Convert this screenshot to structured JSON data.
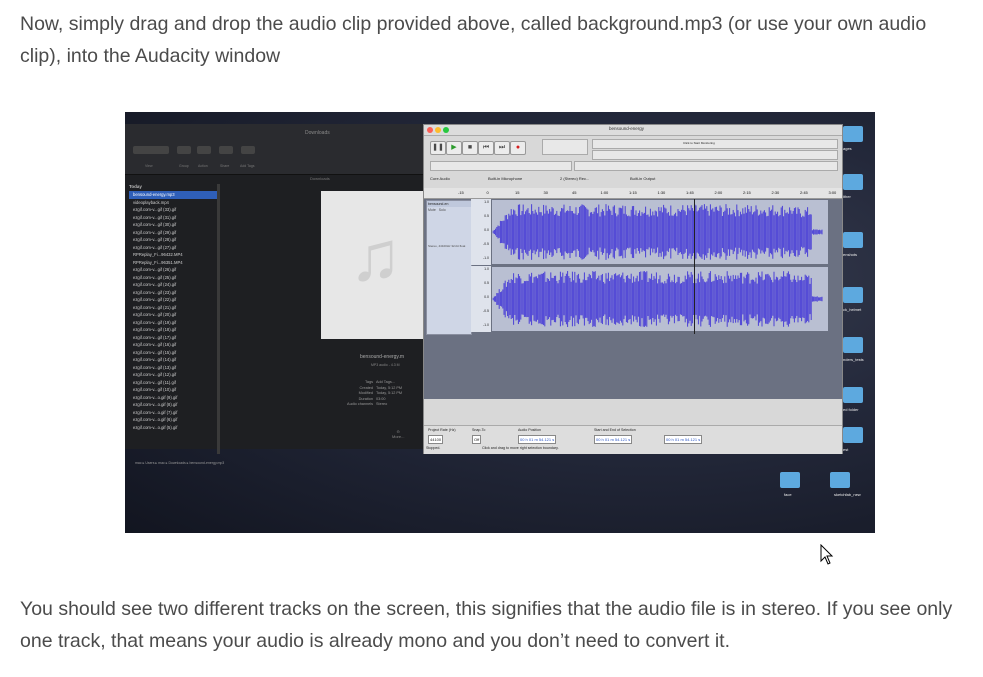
{
  "article": {
    "para1": "Now, simply drag and drop the audio clip provided above, called background.mp3 (or use your own audio clip), into the Audacity window",
    "para2": "You should see two different tracks on the screen, this signifies that the audio file is in stereo. If you see only one track, that means your audio is already mono and you don’t need to convert it."
  },
  "finder": {
    "title": "Downloads",
    "toolbar_labels": [
      "View",
      "Group",
      "Action",
      "Share",
      "Add Tags"
    ],
    "section": "Downloads",
    "today": "Today",
    "files": [
      "bensound-energy.mp3",
      "videoplayback.mp4",
      "ezgif.com-v...gif (33).gif",
      "ezgif.com-v...gif (31).gif",
      "ezgif.com-v...gif (30).gif",
      "ezgif.com-v...gif (29).gif",
      "ezgif.com-v...gif (28).gif",
      "ezgif.com-v...gif (27).gif",
      "RPReplay_Fi...96432.MP4",
      "RPReplay_Fi...96351.MP4",
      "ezgif.com-v...gif (26).gif",
      "ezgif.com-v...gif (25).gif",
      "ezgif.com-v...gif (24).gif",
      "ezgif.com-v...gif (23).gif",
      "ezgif.com-v...gif (22).gif",
      "ezgif.com-v...gif (21).gif",
      "ezgif.com-v...gif (20).gif",
      "ezgif.com-v...gif (19).gif",
      "ezgif.com-v...gif (18).gif",
      "ezgif.com-v...gif (17).gif",
      "ezgif.com-v...gif (16).gif",
      "ezgif.com-v...gif (15).gif",
      "ezgif.com-v...gif (14).gif",
      "ezgif.com-v...gif (13).gif",
      "ezgif.com-v...gif (12).gif",
      "ezgif.com-v...gif (11).gif",
      "ezgif.com-v...gif (10).gif",
      "ezgif.com-v...o.gif (9).gif",
      "ezgif.com-v...o.gif (8).gif",
      "ezgif.com-v...o.gif (7).gif",
      "ezgif.com-v...o.gif (6).gif",
      "ezgif.com-v...o.gif (5).gif"
    ],
    "preview_name": "bensound-energy.m",
    "preview_sub": "MP3 audio - 4.3 M",
    "meta": [
      {
        "k": "Tags",
        "v": "Add Tags..."
      },
      {
        "k": "Created",
        "v": "Today, 5:12 PM"
      },
      {
        "k": "Modified",
        "v": "Today, 5:12 PM"
      },
      {
        "k": "Duration",
        "v": "03:00"
      },
      {
        "k": "Audio channels",
        "v": "Stereo"
      }
    ],
    "more": "More...",
    "path": "mac ▸ Users ▸ mac ▸ Downloads ▸ bensound-energy.mp3"
  },
  "audacity": {
    "title": "bensound-energy",
    "monitor": "Click to Start Monitoring",
    "device_host": "Core Audio",
    "device_in": "Built-in Microphone",
    "channels": "2 (Stereo) Rec...",
    "device_out": "Built-in Output",
    "ruler": [
      "-15",
      "0",
      "15",
      "30",
      "45",
      "1:00",
      "1:15",
      "1:30",
      "1:45",
      "2:00",
      "2:15",
      "2:30",
      "2:45",
      "3:00"
    ],
    "track_name": "bensound-en",
    "mute": "Mute",
    "solo": "Solo",
    "track_info": "Stereo, 44100Hz 32-bit float",
    "scale": [
      "1.0",
      "0.5",
      "0.0",
      "-0.5",
      "-1.0",
      "1.0",
      "0.5",
      "0.0",
      "-0.5",
      "-1.0"
    ],
    "rate_label": "Project Rate (Hz)",
    "rate": "44100",
    "snap_label": "Snap-To",
    "snap": "Off",
    "pos_label": "Audio Position",
    "pos": "00 h 01 m 54.121 s",
    "sel_label": "Start and End of Selection",
    "sel_start": "00 h 01 m 54.121 s",
    "sel_end": "00 h 01 m 54.121 s",
    "status": "Stopped.",
    "hint": "Click and drag to move right selection boundary."
  },
  "desktop": {
    "labels": [
      "ages",
      "ither",
      "enshots",
      "ck_helmet",
      "nders_tests",
      "ed folder",
      "est",
      "face",
      "sketchfab_new"
    ]
  },
  "colors": {
    "wave": "#4a3fd6",
    "track_bg": "#b9bfd2",
    "selection": "#2f5fb8"
  }
}
